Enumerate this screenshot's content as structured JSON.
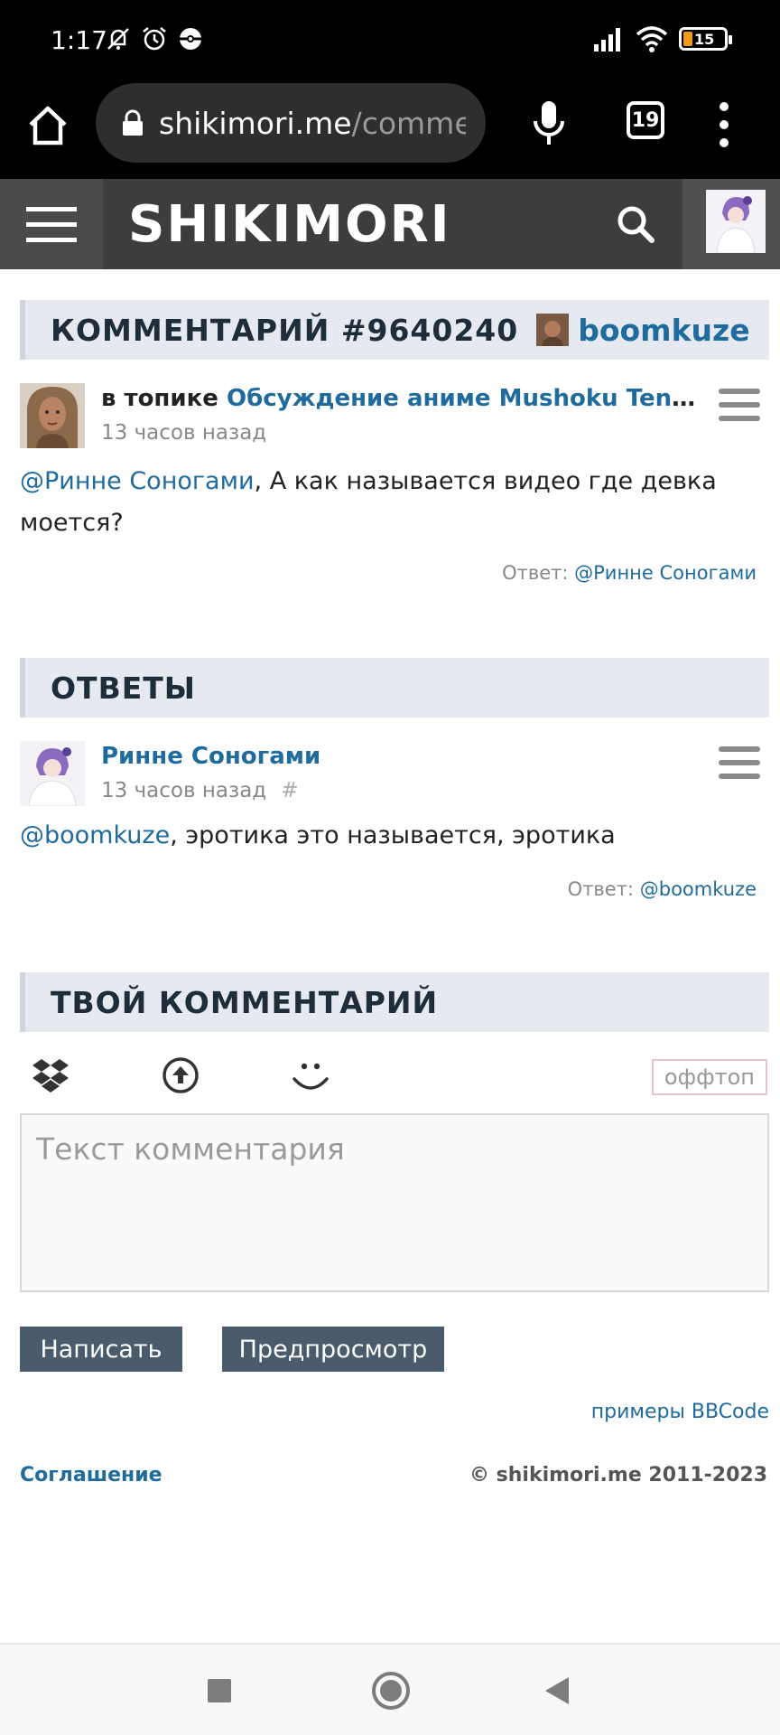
{
  "status_bar": {
    "time": "1:17",
    "icons": [
      "bell-off-icon",
      "alarm-icon",
      "pokeball-icon",
      "signal-icon",
      "wifi-icon",
      "battery-icon"
    ],
    "battery_level": "15"
  },
  "browser": {
    "url_host": "shikimori.me",
    "url_path": "/comme",
    "tab_count": "19"
  },
  "site": {
    "logo": "SHIKIMORI"
  },
  "comment_section": {
    "title": "КОММЕНТАРИЙ #9640240",
    "author": "boomkuze"
  },
  "comment": {
    "prefix": "в топике",
    "topic_link": "Обсуждение аниме Mushoku Tensei I...",
    "time": "13 часов назад",
    "mention": "@Ринне Соногами",
    "text": ", А как называется видео где девка моется?",
    "reply_label": "Ответ:",
    "reply_mention": "@Ринне Соногами"
  },
  "replies_section": {
    "title": "ОТВЕТЫ"
  },
  "reply": {
    "author": "Ринне Соногами",
    "time": "13 часов назад",
    "hash": "#",
    "mention": "@boomkuze",
    "text": ", эротика это называется, эротика",
    "reply_label": "Ответ:",
    "reply_mention": "@boomkuze"
  },
  "your_comment_section": {
    "title": "ТВОЙ КОММЕНТАРИЙ"
  },
  "editor": {
    "tools": [
      "dropbox-icon",
      "upload-icon",
      "smiley-icon"
    ],
    "offtopic": "оффтоп",
    "placeholder": "Текст комментария",
    "submit": "Написать",
    "preview": "Предпросмотр",
    "bbcode_link": "примеры BBCode"
  },
  "footer": {
    "agreement": "Соглашение",
    "copyright": "© shikimori.me 2011-2023"
  },
  "colors": {
    "link": "#1f6b9e",
    "section_bg": "#e6eaf0",
    "button_bg": "#4a5b6c",
    "header_bg": "#3d3d3d"
  }
}
